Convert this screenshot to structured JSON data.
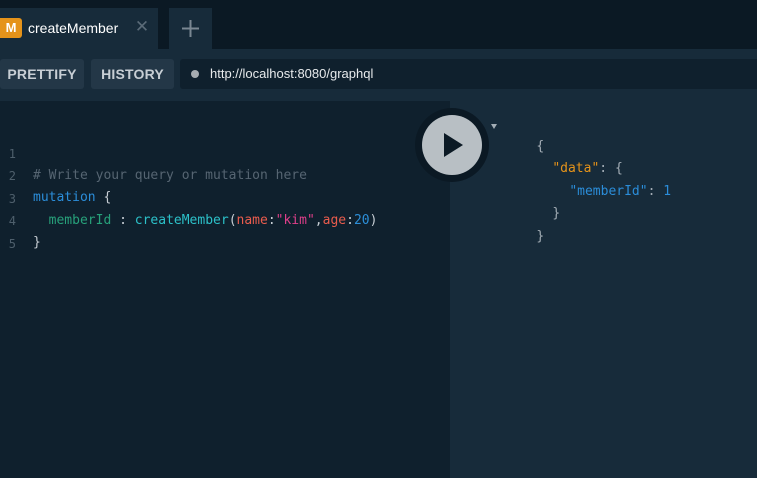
{
  "tab": {
    "badge": "M",
    "title": "createMember",
    "close_glyph": "✕"
  },
  "toolbar": {
    "prettify_label": "PRETTIFY",
    "history_label": "HISTORY",
    "url": "http://localhost:8080/graphql"
  },
  "editor": {
    "line_numbers": [
      "1",
      "2",
      "3",
      "4",
      "5"
    ],
    "comment": "# Write your query or mutation here",
    "keyword": "mutation",
    "open_brace": "{",
    "field_alias": "memberId",
    "alias_colon": ":",
    "call_name": "createMember",
    "open_paren": "(",
    "arg1_name": "name",
    "colon": ":",
    "arg1_value": "\"kim\"",
    "comma": ",",
    "arg2_name": "age",
    "arg2_value": "20",
    "close_paren": ")",
    "close_brace": "}"
  },
  "result": {
    "open_brace": "{",
    "data_key": "\"data\"",
    "colon": ":",
    "inner_open": "{",
    "member_key": "\"memberId\"",
    "member_value": "1",
    "inner_close": "}",
    "close_brace": "}"
  },
  "icons": {
    "add_tab": "plus-icon",
    "run": "play-icon",
    "fold": "fold-arrow-icon"
  },
  "colors": {
    "badge": "#e5931a",
    "keyword": "#2b8dd9",
    "field": "#27a17a",
    "call": "#2cc1c9",
    "argument": "#ea5c4d",
    "string": "#df3f8a",
    "comment": "#566572"
  }
}
